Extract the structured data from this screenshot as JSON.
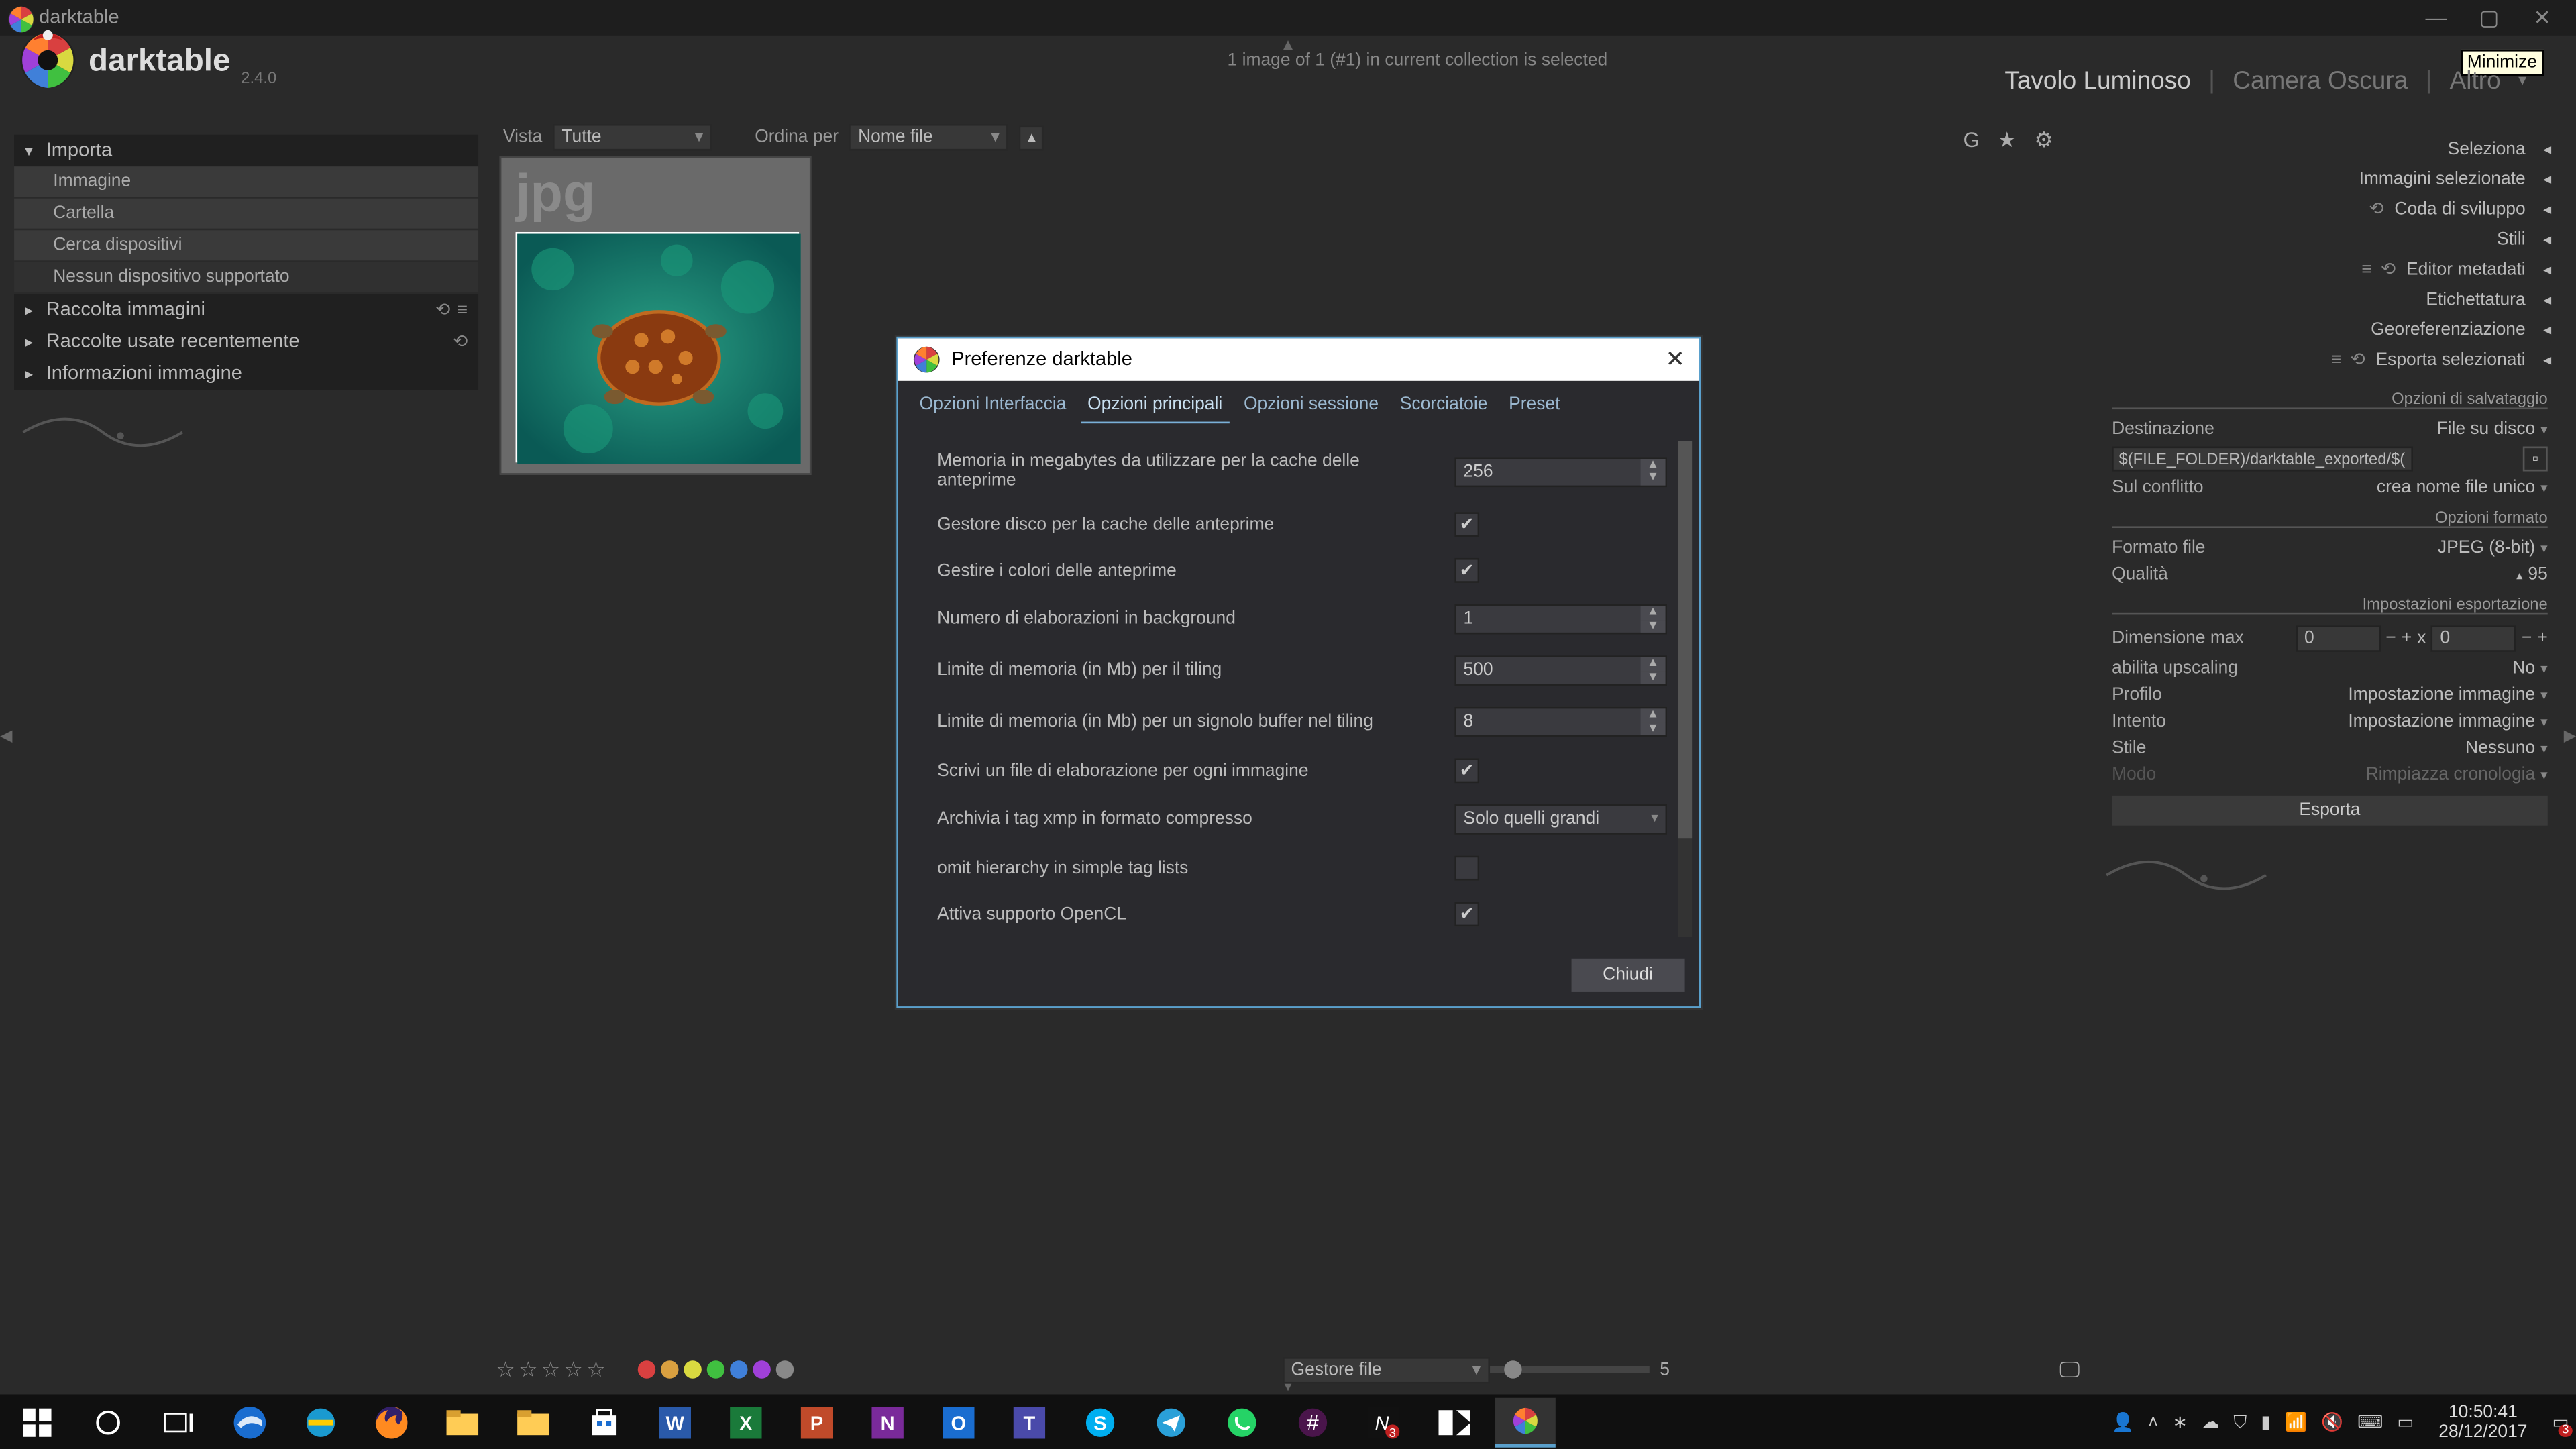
{
  "window": {
    "title": "darktable",
    "tooltip": "Minimize"
  },
  "app": {
    "name": "darktable",
    "version": "2.4.0"
  },
  "header": {
    "status": "1 image of 1 (#1) in current collection is selected"
  },
  "top_tabs": {
    "lighttable": "Tavolo Luminoso",
    "darkroom": "Camera Oscura",
    "other": "Altro"
  },
  "top_icons": {
    "group": "G",
    "star": "★",
    "gear": "⚙"
  },
  "center_toolbar": {
    "view_label": "Vista",
    "view_value": "Tutte",
    "sort_label": "Ordina per",
    "sort_value": "Nome file"
  },
  "thumb": {
    "ext": "jpg"
  },
  "left": {
    "import": {
      "title": "Importa",
      "items": [
        "Immagine",
        "Cartella",
        "Cerca dispositivi",
        "Nessun dispositivo supportato"
      ]
    },
    "collect": {
      "title": "Raccolta immagini"
    },
    "recent": {
      "title": "Raccolte usate recentemente"
    },
    "info": {
      "title": "Informazioni immagine"
    }
  },
  "right": {
    "select": {
      "title": "Seleziona"
    },
    "selected": {
      "title": "Immagini selezionate"
    },
    "queue": {
      "title": "Coda di sviluppo"
    },
    "styles": {
      "title": "Stili"
    },
    "metadata": {
      "title": "Editor metadati"
    },
    "tagging": {
      "title": "Etichettatura"
    },
    "geo": {
      "title": "Georeferenziazione"
    },
    "export": {
      "title": "Esporta selezionati",
      "grp_storage": "Opzioni di salvataggio",
      "dest_label": "Destinazione",
      "dest_value": "File su disco",
      "path_value": "$(FILE_FOLDER)/darktable_exported/$(FILE_NAME)",
      "conflict_label": "Sul conflitto",
      "conflict_value": "crea nome file unico",
      "grp_format": "Opzioni formato",
      "format_label": "Formato file",
      "format_value": "JPEG (8-bit)",
      "quality_label": "Qualità",
      "quality_value": "95",
      "grp_export": "Impostazioni esportazione",
      "maxdim_label": "Dimensione max",
      "maxdim_w": "0",
      "maxdim_x": "x",
      "maxdim_h": "0",
      "upscale_label": "abilita upscaling",
      "upscale_value": "No",
      "profile_label": "Profilo",
      "profile_value": "Impostazione immagine",
      "intent_label": "Intento",
      "intent_value": "Impostazione immagine",
      "style_label": "Stile",
      "style_value": "Nessuno",
      "mode_label": "Modo",
      "mode_value": "Rimpiazza cronologia",
      "button": "Esporta"
    }
  },
  "bottom": {
    "filemgr": "Gestore file",
    "slider_value": "5"
  },
  "dialog": {
    "title": "Preferenze darktable",
    "tabs": [
      "Opzioni Interfaccia",
      "Opzioni principali",
      "Opzioni sessione",
      "Scorciatoie",
      "Preset"
    ],
    "active_tab": 1,
    "rows": [
      {
        "label": "Memoria in megabytes da utilizzare per la cache delle anteprime",
        "type": "spin",
        "value": "256"
      },
      {
        "label": "Gestore disco per la cache delle anteprime",
        "type": "check",
        "value": true
      },
      {
        "label": "Gestire i colori delle anteprime",
        "type": "check",
        "value": true
      },
      {
        "label": "Numero di elaborazioni in background",
        "type": "spin",
        "value": "1"
      },
      {
        "label": "Limite di memoria (in Mb) per il tiling",
        "type": "spin",
        "value": "500"
      },
      {
        "label": "Limite di memoria (in Mb) per un signolo buffer nel tiling",
        "type": "spin",
        "value": "8"
      },
      {
        "label": "Scrivi un file di elaborazione per ogni immagine",
        "type": "check",
        "value": true
      },
      {
        "label": "Archivia i tag xmp in formato compresso",
        "type": "combo",
        "value": "Solo quelli grandi"
      },
      {
        "label": "omit hierarchy in simple tag lists",
        "type": "check",
        "value": false
      },
      {
        "label": "Attiva supporto OpenCL",
        "type": "check",
        "value": true
      }
    ],
    "close": "Chiudi"
  },
  "taskbar": {
    "time": "10:50:41",
    "date": "28/12/2017"
  },
  "colors": {
    "dots": [
      "#d94040",
      "#d9a040",
      "#d9d940",
      "#40c040",
      "#4080d9",
      "#a040d9",
      "#888888"
    ]
  }
}
